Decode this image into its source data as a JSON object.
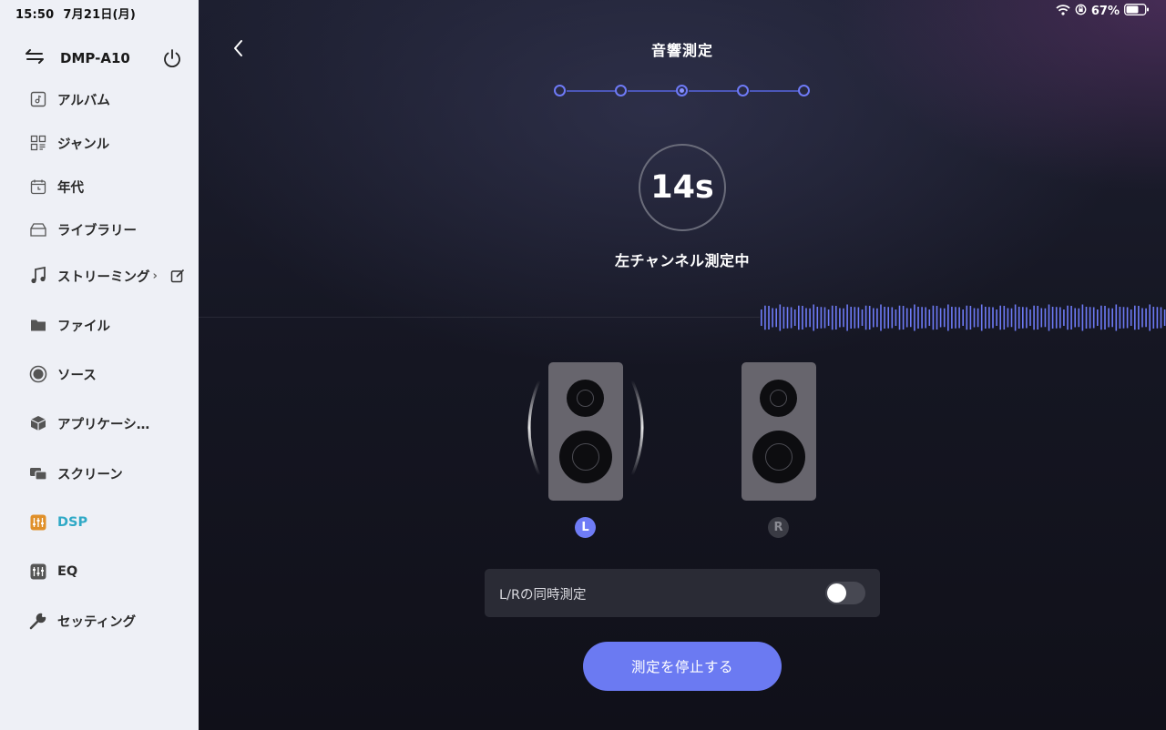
{
  "status_bar": {
    "time": "15:50",
    "date": "7月21日(月)",
    "battery_percent": "67%",
    "icons": [
      "wifi-icon",
      "orientation-lock-icon",
      "battery-icon"
    ]
  },
  "sidebar": {
    "device_name": "DMP-A10",
    "items": [
      {
        "label": "アルバム",
        "icon": "album-icon"
      },
      {
        "label": "ジャンル",
        "icon": "genre-icon"
      },
      {
        "label": "年代",
        "icon": "calendar-icon"
      },
      {
        "label": "ライブラリー",
        "icon": "library-icon"
      },
      {
        "label": "ストリーミング",
        "icon": "music-note-icon"
      },
      {
        "label": "ファイル",
        "icon": "folder-icon"
      },
      {
        "label": "ソース",
        "icon": "source-icon"
      },
      {
        "label": "アプリケーシ…",
        "icon": "cube-icon"
      },
      {
        "label": "スクリーン",
        "icon": "screen-icon"
      },
      {
        "label": "DSP",
        "icon": "dsp-icon",
        "active": true
      },
      {
        "label": "EQ",
        "icon": "eq-icon"
      },
      {
        "label": "セッティング",
        "icon": "wrench-icon"
      }
    ],
    "active_color": "#2fa9c6"
  },
  "main": {
    "title": "音響測定",
    "stepper": {
      "total": 5,
      "current": 3
    },
    "timer": "14s",
    "status_text": "左チャンネル測定中",
    "speakers": {
      "left_label": "L",
      "right_label": "R",
      "active": "L"
    },
    "toggle": {
      "label": "L/Rの同時測定",
      "on": false
    },
    "stop_button": "測定を停止する",
    "accent_color": "#6b7af2"
  }
}
